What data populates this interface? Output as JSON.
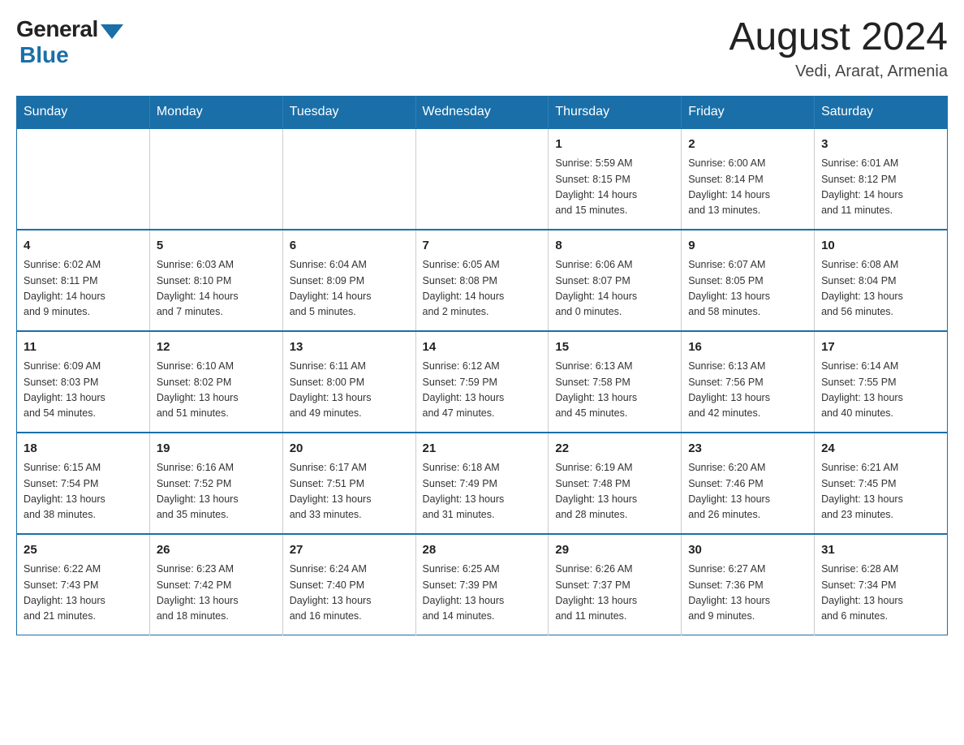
{
  "header": {
    "logo_general": "General",
    "logo_blue": "Blue",
    "month_title": "August 2024",
    "location": "Vedi, Ararat, Armenia"
  },
  "days_of_week": [
    "Sunday",
    "Monday",
    "Tuesday",
    "Wednesday",
    "Thursday",
    "Friday",
    "Saturday"
  ],
  "weeks": [
    [
      {
        "day": "",
        "info": ""
      },
      {
        "day": "",
        "info": ""
      },
      {
        "day": "",
        "info": ""
      },
      {
        "day": "",
        "info": ""
      },
      {
        "day": "1",
        "info": "Sunrise: 5:59 AM\nSunset: 8:15 PM\nDaylight: 14 hours\nand 15 minutes."
      },
      {
        "day": "2",
        "info": "Sunrise: 6:00 AM\nSunset: 8:14 PM\nDaylight: 14 hours\nand 13 minutes."
      },
      {
        "day": "3",
        "info": "Sunrise: 6:01 AM\nSunset: 8:12 PM\nDaylight: 14 hours\nand 11 minutes."
      }
    ],
    [
      {
        "day": "4",
        "info": "Sunrise: 6:02 AM\nSunset: 8:11 PM\nDaylight: 14 hours\nand 9 minutes."
      },
      {
        "day": "5",
        "info": "Sunrise: 6:03 AM\nSunset: 8:10 PM\nDaylight: 14 hours\nand 7 minutes."
      },
      {
        "day": "6",
        "info": "Sunrise: 6:04 AM\nSunset: 8:09 PM\nDaylight: 14 hours\nand 5 minutes."
      },
      {
        "day": "7",
        "info": "Sunrise: 6:05 AM\nSunset: 8:08 PM\nDaylight: 14 hours\nand 2 minutes."
      },
      {
        "day": "8",
        "info": "Sunrise: 6:06 AM\nSunset: 8:07 PM\nDaylight: 14 hours\nand 0 minutes."
      },
      {
        "day": "9",
        "info": "Sunrise: 6:07 AM\nSunset: 8:05 PM\nDaylight: 13 hours\nand 58 minutes."
      },
      {
        "day": "10",
        "info": "Sunrise: 6:08 AM\nSunset: 8:04 PM\nDaylight: 13 hours\nand 56 minutes."
      }
    ],
    [
      {
        "day": "11",
        "info": "Sunrise: 6:09 AM\nSunset: 8:03 PM\nDaylight: 13 hours\nand 54 minutes."
      },
      {
        "day": "12",
        "info": "Sunrise: 6:10 AM\nSunset: 8:02 PM\nDaylight: 13 hours\nand 51 minutes."
      },
      {
        "day": "13",
        "info": "Sunrise: 6:11 AM\nSunset: 8:00 PM\nDaylight: 13 hours\nand 49 minutes."
      },
      {
        "day": "14",
        "info": "Sunrise: 6:12 AM\nSunset: 7:59 PM\nDaylight: 13 hours\nand 47 minutes."
      },
      {
        "day": "15",
        "info": "Sunrise: 6:13 AM\nSunset: 7:58 PM\nDaylight: 13 hours\nand 45 minutes."
      },
      {
        "day": "16",
        "info": "Sunrise: 6:13 AM\nSunset: 7:56 PM\nDaylight: 13 hours\nand 42 minutes."
      },
      {
        "day": "17",
        "info": "Sunrise: 6:14 AM\nSunset: 7:55 PM\nDaylight: 13 hours\nand 40 minutes."
      }
    ],
    [
      {
        "day": "18",
        "info": "Sunrise: 6:15 AM\nSunset: 7:54 PM\nDaylight: 13 hours\nand 38 minutes."
      },
      {
        "day": "19",
        "info": "Sunrise: 6:16 AM\nSunset: 7:52 PM\nDaylight: 13 hours\nand 35 minutes."
      },
      {
        "day": "20",
        "info": "Sunrise: 6:17 AM\nSunset: 7:51 PM\nDaylight: 13 hours\nand 33 minutes."
      },
      {
        "day": "21",
        "info": "Sunrise: 6:18 AM\nSunset: 7:49 PM\nDaylight: 13 hours\nand 31 minutes."
      },
      {
        "day": "22",
        "info": "Sunrise: 6:19 AM\nSunset: 7:48 PM\nDaylight: 13 hours\nand 28 minutes."
      },
      {
        "day": "23",
        "info": "Sunrise: 6:20 AM\nSunset: 7:46 PM\nDaylight: 13 hours\nand 26 minutes."
      },
      {
        "day": "24",
        "info": "Sunrise: 6:21 AM\nSunset: 7:45 PM\nDaylight: 13 hours\nand 23 minutes."
      }
    ],
    [
      {
        "day": "25",
        "info": "Sunrise: 6:22 AM\nSunset: 7:43 PM\nDaylight: 13 hours\nand 21 minutes."
      },
      {
        "day": "26",
        "info": "Sunrise: 6:23 AM\nSunset: 7:42 PM\nDaylight: 13 hours\nand 18 minutes."
      },
      {
        "day": "27",
        "info": "Sunrise: 6:24 AM\nSunset: 7:40 PM\nDaylight: 13 hours\nand 16 minutes."
      },
      {
        "day": "28",
        "info": "Sunrise: 6:25 AM\nSunset: 7:39 PM\nDaylight: 13 hours\nand 14 minutes."
      },
      {
        "day": "29",
        "info": "Sunrise: 6:26 AM\nSunset: 7:37 PM\nDaylight: 13 hours\nand 11 minutes."
      },
      {
        "day": "30",
        "info": "Sunrise: 6:27 AM\nSunset: 7:36 PM\nDaylight: 13 hours\nand 9 minutes."
      },
      {
        "day": "31",
        "info": "Sunrise: 6:28 AM\nSunset: 7:34 PM\nDaylight: 13 hours\nand 6 minutes."
      }
    ]
  ]
}
